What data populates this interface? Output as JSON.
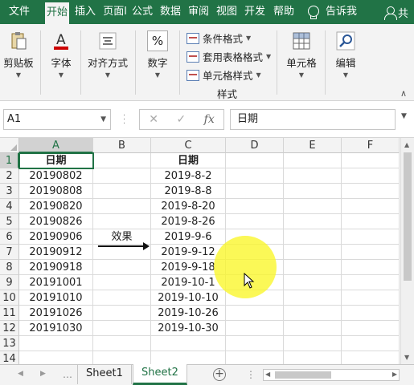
{
  "ribbon_tabs": [
    {
      "label": "文件",
      "active": false
    },
    {
      "label": "开始",
      "active": true
    },
    {
      "label": "插入",
      "active": false
    },
    {
      "label": "页面l",
      "active": false
    },
    {
      "label": "公式",
      "active": false
    },
    {
      "label": "数据",
      "active": false
    },
    {
      "label": "审阅",
      "active": false
    },
    {
      "label": "视图",
      "active": false
    },
    {
      "label": "开发",
      "active": false
    },
    {
      "label": "帮助",
      "active": false
    }
  ],
  "tell_me": "告诉我",
  "share": "共",
  "ribbon": {
    "clipboard": "剪贴板",
    "font": "字体",
    "alignment": "对齐方式",
    "number": "数字",
    "number_symbol": "%",
    "cond_format": "条件格式",
    "table_format": "套用表格格式",
    "cell_styles": "单元格样式",
    "styles_group": "样式",
    "cells": "单元格",
    "editing": "编辑",
    "font_symbol": "A"
  },
  "formula_bar": {
    "name_box": "A1",
    "fx": "fx",
    "cancel": "✕",
    "enter": "✓",
    "content": "日期"
  },
  "columns": [
    "A",
    "B",
    "C",
    "D",
    "E",
    "F"
  ],
  "rows": [
    "1",
    "2",
    "3",
    "4",
    "5",
    "6",
    "7",
    "8",
    "9",
    "10",
    "11",
    "12",
    "13",
    "14"
  ],
  "cells": {
    "A": [
      "日期",
      "20190802",
      "20190808",
      "20190820",
      "20190826",
      "20190906",
      "20190912",
      "20190918",
      "20191001",
      "20191010",
      "20191026",
      "20191030",
      "",
      ""
    ],
    "B": [
      "",
      "",
      "",
      "",
      "",
      "效果",
      "",
      "",
      "",
      "",
      "",
      "",
      "",
      ""
    ],
    "C": [
      "日期",
      "2019-8-2",
      "2019-8-8",
      "2019-8-20",
      "2019-8-26",
      "2019-9-6",
      "2019-9-12",
      "2019-9-18",
      "2019-10-1",
      "2019-10-10",
      "2019-10-26",
      "2019-10-30",
      "",
      ""
    ]
  },
  "sheets": [
    {
      "name": "Sheet1",
      "active": false
    },
    {
      "name": "Sheet2",
      "active": true
    }
  ],
  "colors": {
    "excel_green": "#217346",
    "highlight": "#faf628"
  }
}
